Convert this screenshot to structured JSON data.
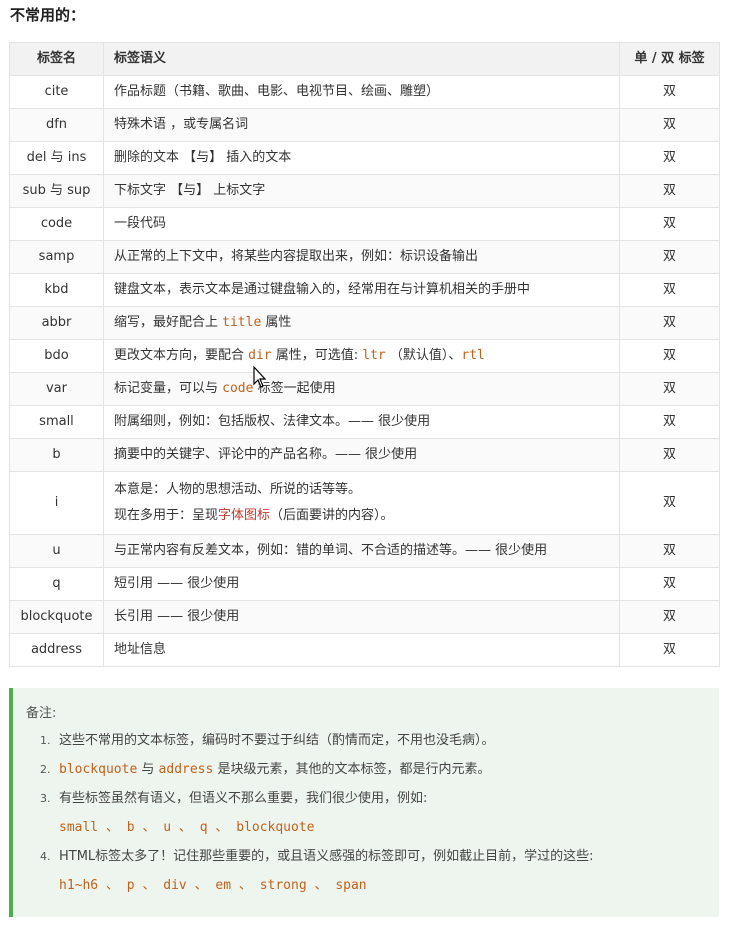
{
  "heading": "不常用的：",
  "table": {
    "headers": [
      "标签名",
      "标签语义",
      "单 / 双 标签"
    ],
    "rows": [
      {
        "tag": "cite",
        "desc": "作品标题（书籍、歌曲、电影、电视节目、绘画、雕塑）",
        "type": "双"
      },
      {
        "tag": "dfn",
        "desc": "特殊术语 ，或专属名词",
        "type": "双"
      },
      {
        "tag": "del 与 ins",
        "desc": "删除的文本 【与】 插入的文本",
        "type": "双"
      },
      {
        "tag": "sub 与 sup",
        "desc": "下标文字 【与】 上标文字",
        "type": "双"
      },
      {
        "tag": "code",
        "desc": "一段代码",
        "type": "双"
      },
      {
        "tag": "samp",
        "desc": "从正常的上下文中，将某些内容提取出来，例如：标识设备输出",
        "type": "双"
      },
      {
        "tag": "kbd",
        "desc": "键盘文本，表示文本是通过键盘输入的，经常用在与计算机相关的手册中",
        "type": "双"
      },
      {
        "tag": "abbr",
        "desc_a": "缩写，最好配合上 ",
        "desc_code": "title",
        "desc_b": " 属性",
        "type": "双"
      },
      {
        "tag": "bdo",
        "desc_a": "更改文本方向，要配合 ",
        "desc_code1": "dir",
        "desc_b": " 属性，可选值: ",
        "desc_code2": "ltr",
        "desc_c": " （默认值）、",
        "desc_code3": "rtl",
        "type": "双"
      },
      {
        "tag": "var",
        "desc_a": "标记变量，可以与 ",
        "desc_code": "code",
        "desc_b": " 标签一起使用",
        "type": "双"
      },
      {
        "tag": "small",
        "desc": "附属细则，例如：包括版权、法律文本。—— 很少使用",
        "type": "双"
      },
      {
        "tag": "b",
        "desc": "摘要中的关键字、评论中的产品名称。—— 很少使用",
        "type": "双"
      },
      {
        "tag": "i",
        "desc_line1": "本意是：人物的思想活动、所说的话等等。",
        "desc_line2_a": "现在多用于：呈现",
        "desc_line2_red": "字体图标",
        "desc_line2_b": "（后面要讲的内容）。",
        "type": "双"
      },
      {
        "tag": "u",
        "desc": "与正常内容有反差文本，例如：错的单词、不合适的描述等。—— 很少使用",
        "type": "双"
      },
      {
        "tag": "q",
        "desc": "短引用 —— 很少使用",
        "type": "双"
      },
      {
        "tag": "blockquote",
        "desc": "长引用 —— 很少使用",
        "type": "双"
      },
      {
        "tag": "address",
        "desc": "地址信息",
        "type": "双"
      }
    ]
  },
  "note": {
    "title": "备注:",
    "items": [
      {
        "num": "1.",
        "text": "这些不常用的文本标签，编码时不要过于纠结（酌情而定，不用也没毛病）。"
      },
      {
        "num": "2.",
        "code1": "blockquote",
        "mid": " 与 ",
        "code2": "address",
        "text": " 是块级元素，其他的文本标签，都是行内元素。"
      },
      {
        "num": "3.",
        "text": "有些标签虽然有语义，但语义不那么重要，我们很少使用，例如:",
        "codes": "small 、 b 、 u 、 q 、 blockquote"
      },
      {
        "num": "4.",
        "text": "HTML标签太多了！记住那些重要的，或且语义感强的标签即可，例如截止目前，学过的这些:",
        "codes": "h1~h6 、 p 、 div 、 em 、 strong 、 span"
      }
    ]
  }
}
